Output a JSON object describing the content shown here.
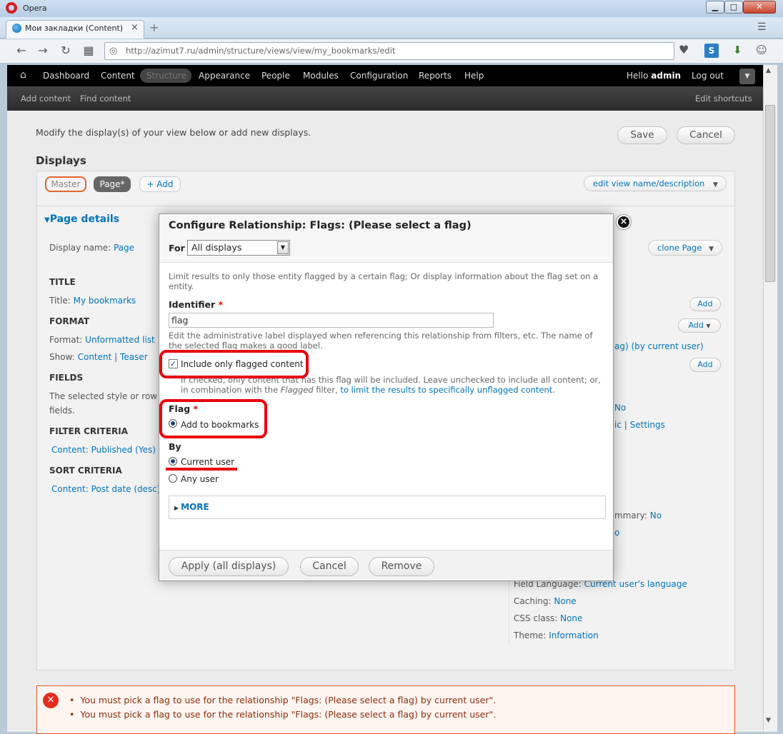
{
  "browser": {
    "app_name": "Opera",
    "window_buttons": {
      "minimize": "▁",
      "maximize": "□",
      "close": "✕"
    },
    "tab_title": "Мои закладки (Content) | Sit",
    "tab_close": "×",
    "new_tab": "+",
    "url_host": "http://azimut7.ru",
    "url_path": "/admin/structure/views/view/my_bookmarks/edit"
  },
  "toolbar": {
    "items": [
      "Dashboard",
      "Content",
      "Structure",
      "Appearance",
      "People",
      "Modules",
      "Configuration",
      "Reports",
      "Help"
    ],
    "active": "Structure",
    "hello_prefix": "Hello",
    "username": "admin",
    "logout": "Log out",
    "shortcuts": [
      "Add content",
      "Find content"
    ],
    "edit_shortcuts": "Edit shortcuts"
  },
  "page": {
    "intro": "Modify the display(s) of your view below or add new displays.",
    "save": "Save",
    "cancel": "Cancel",
    "displays_heading": "Displays",
    "tabs": {
      "master": "Master",
      "page": "Page*",
      "add": "+ Add"
    },
    "edit_view_name": "edit view name/description",
    "page_details": "Page details",
    "display_name_label": "Display name:",
    "display_name_value": "Page",
    "clone_page": "clone Page",
    "title_heading": "TITLE",
    "title_label": "Title:",
    "title_value": "My bookmarks",
    "format_heading": "FORMAT",
    "format_label": "Format:",
    "format_value": "Unformatted list",
    "show_label": "Show:",
    "show_value": "Content",
    "show_sep": "|",
    "show_value2": "Teaser",
    "fields_heading": "FIELDS",
    "fields_text1": "The selected style or row f",
    "fields_text2": "fields.",
    "filter_heading": "FILTER CRITERIA",
    "filter_value": "Content: Published (Yes)",
    "sort_heading": "SORT CRITERIA",
    "sort_value": "Content: Post date (desc)",
    "right_add": "Add",
    "right_relationship": "ag) (by current user)",
    "right_no1": "No",
    "right_ic": "ic",
    "right_settings_sep": "|",
    "right_settings": "Settings",
    "right_mmary_label": "mmary:",
    "right_mmary_value": "No",
    "right_o": "o",
    "field_language_label": "Field Language:",
    "field_language_value": "Current user's language",
    "caching_label": "Caching:",
    "caching_value": "None",
    "css_label": "CSS class:",
    "css_value": "None",
    "theme_label": "Theme:",
    "theme_value": "Information"
  },
  "errors": [
    "You must pick a flag to use for the relationship \"Flags: (Please select a flag) by current user\".",
    "You must pick a flag to use for the relationship \"Flags: (Please select a flag) by current user\"."
  ],
  "modal": {
    "title": "Configure Relationship: Flags: (Please select a flag)",
    "close": "×",
    "for_label": "For",
    "for_value": "All displays",
    "description": "Limit results to only those entity flagged by a certain flag; Or display information about the flag set on a entity.",
    "identifier_label": "Identifier",
    "required_mark": "*",
    "identifier_value": "flag",
    "identifier_help": "Edit the administrative label displayed when referencing this relationship from filters, etc. The name of the selected flag makes a good label.",
    "checkbox_label": "Include only flagged content",
    "checkbox_checked": true,
    "checkbox_help_prefix": "If checked, only content that has this flag will be included. Leave unchecked to include all content; or, in combination with the ",
    "checkbox_help_em": "Flagged",
    "checkbox_help_mid": " filter, ",
    "checkbox_help_link": "to limit the results to specifically unflagged content",
    "checkbox_help_end": ".",
    "flag_label": "Flag",
    "flag_option": "Add to bookmarks",
    "by_label": "By",
    "by_options": [
      "Current user",
      "Any user"
    ],
    "by_selected": "Current user",
    "more": "MORE",
    "apply": "Apply (all displays)",
    "cancel": "Cancel",
    "remove": "Remove"
  },
  "colors": {
    "annotation": "#e8000c",
    "link": "#0074bd",
    "toolbar": "#000000",
    "error": "#e52c1d"
  }
}
